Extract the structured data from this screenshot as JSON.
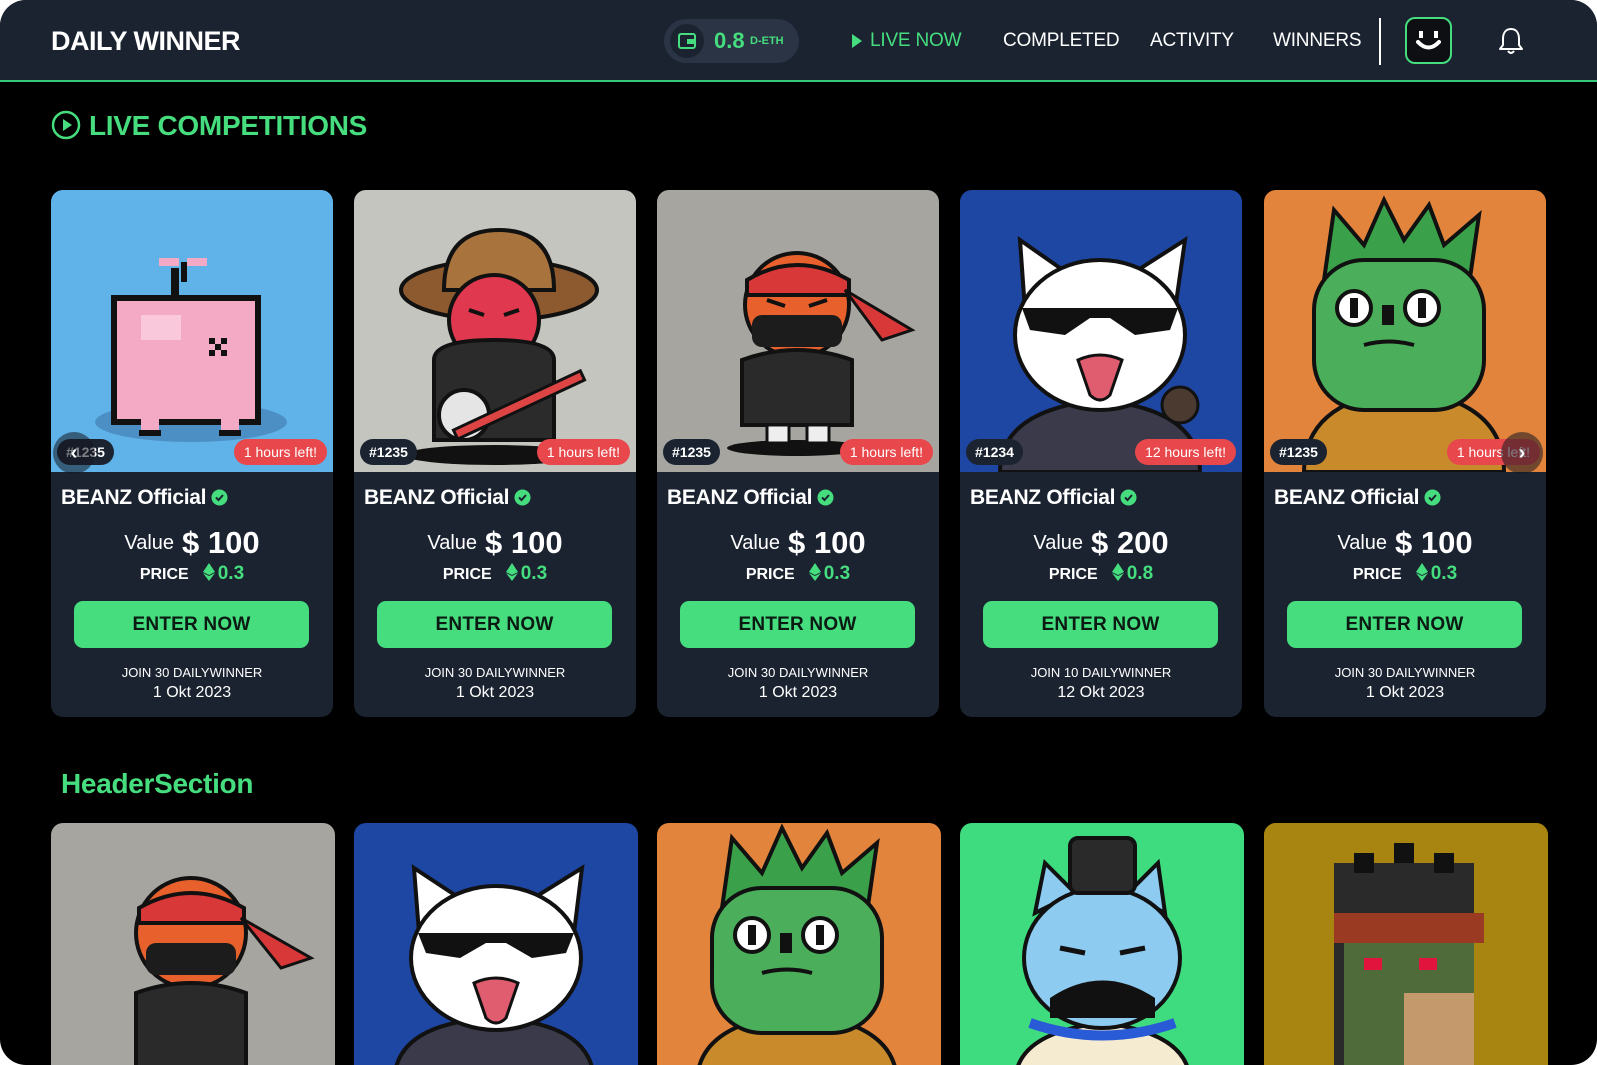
{
  "header": {
    "logo": "DAILY WINNER",
    "wallet": {
      "value": "0.8",
      "unit": "D-ETH"
    },
    "nav": [
      "LIVE NOW",
      "COMPLETED",
      "ACTIVITY",
      "WINNERS"
    ],
    "active_nav": "LIVE NOW"
  },
  "live_section": {
    "title": "LIVE COMPETITIONS"
  },
  "cards": [
    {
      "id": "#1235",
      "time_left": "1 hours left!",
      "brand": "BEANZ Official",
      "value_label": "Value",
      "value": "$ 100",
      "price_label": "PRICE",
      "price": "0.3",
      "button": "ENTER NOW",
      "join": "JOIN 30 DAILYWINNER",
      "date": "1 Okt 2023",
      "art": "pink-pixel-creature"
    },
    {
      "id": "#1235",
      "time_left": "1 hours left!",
      "brand": "BEANZ Official",
      "value_label": "Value",
      "value": "$ 100",
      "price_label": "PRICE",
      "price": "0.3",
      "button": "ENTER NOW",
      "join": "JOIN 30 DAILYWINNER",
      "date": "1 Okt 2023",
      "art": "red-bean-straw-hat"
    },
    {
      "id": "#1235",
      "time_left": "1 hours left!",
      "brand": "BEANZ Official",
      "value_label": "Value",
      "value": "$ 100",
      "price_label": "PRICE",
      "price": "0.3",
      "button": "ENTER NOW",
      "join": "JOIN 30 DAILYWINNER",
      "date": "1 Okt 2023",
      "art": "ninja-bean"
    },
    {
      "id": "#1234",
      "time_left": "12 hours left!",
      "brand": "BEANZ Official",
      "value_label": "Value",
      "value": "$ 200",
      "price_label": "PRICE",
      "price": "0.8",
      "button": "ENTER NOW",
      "join": "JOIN 10 DAILYWINNER",
      "date": "12 Okt 2023",
      "art": "white-cat-sunglasses"
    },
    {
      "id": "#1235",
      "time_left": "1 hours left!",
      "brand": "BEANZ Official",
      "value_label": "Value",
      "value": "$ 100",
      "price_label": "PRICE",
      "price": "0.3",
      "button": "ENTER NOW",
      "join": "JOIN 30 DAILYWINNER",
      "date": "1 Okt 2023",
      "art": "green-lizard-man"
    }
  ],
  "section2": {
    "title": "HeaderSection"
  },
  "row2_art": [
    "ninja-bean",
    "white-cat-sunglasses",
    "green-lizard-man",
    "blue-cat-top-hat",
    "pixel-punk-portrait"
  ],
  "colors": {
    "accent": "#45dd7e",
    "card_bg": "#1b2331",
    "nav_bg": "#1b2331",
    "badge_red": "#e8474b",
    "page_bg": "#000000"
  }
}
